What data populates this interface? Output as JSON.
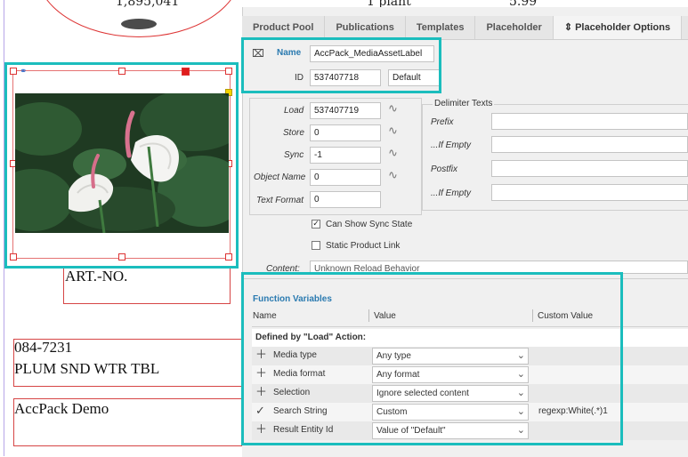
{
  "document": {
    "top_text_1": "1,895,041",
    "top_text_2": "1 plant",
    "top_text_3": "5.99",
    "art_no": "ART.-NO.",
    "item_code": "084-7231",
    "item_name": "PLUM SND WTR TBL",
    "footer_text": "AccPack Demo"
  },
  "tabs": [
    {
      "label": "Product Pool"
    },
    {
      "label": "Publications"
    },
    {
      "label": "Templates"
    },
    {
      "label": "Placeholder"
    },
    {
      "label": "Placeholder Options",
      "icon": "chevrons-updown-icon",
      "active": true
    }
  ],
  "header": {
    "name_label": "Name",
    "name_value": "AccPack_MediaAssetLabel",
    "id_label": "ID",
    "id_value": "537407718",
    "id_extra": "Default"
  },
  "actions": [
    {
      "label": "Load",
      "value": "537407719"
    },
    {
      "label": "Store",
      "value": "0"
    },
    {
      "label": "Sync",
      "value": "-1"
    },
    {
      "label": "Object Name",
      "value": "0"
    },
    {
      "label": "Text Format",
      "value": "0"
    }
  ],
  "delimiter": {
    "title": "Delimiter Texts",
    "fields": [
      {
        "label": "Prefix",
        "value": ""
      },
      {
        "label": "...If Empty",
        "value": ""
      },
      {
        "label": "Postfix",
        "value": ""
      },
      {
        "label": "...If Empty",
        "value": ""
      }
    ]
  },
  "checkboxes": [
    {
      "label": "Can Show Sync State",
      "checked": true
    },
    {
      "label": "Static Product Link",
      "checked": false
    }
  ],
  "content": {
    "label": "Content:",
    "value": "Unknown Reload Behavior"
  },
  "function_vars": {
    "title": "Function Variables",
    "columns": [
      "Name",
      "Value",
      "Custom Value"
    ],
    "group_title": "Defined by \"Load\" Action:",
    "rows": [
      {
        "icon": "plus-icon",
        "name": "Media type",
        "value": "Any type",
        "custom": ""
      },
      {
        "icon": "plus-icon",
        "name": "Media format",
        "value": "Any format",
        "custom": ""
      },
      {
        "icon": "plus-icon",
        "name": "Selection",
        "value": "Ignore selected content",
        "custom": ""
      },
      {
        "icon": "check-icon",
        "name": "Search String",
        "value": "Custom",
        "custom": "regexp:White(.*)1"
      },
      {
        "icon": "plus-icon",
        "name": "Result Entity Id",
        "value": "Value of \"Default\"",
        "custom": ""
      }
    ]
  },
  "colors": {
    "highlight": "#1bbdbd",
    "frame": "#d64545",
    "accent_blue": "#2a7ab0"
  }
}
